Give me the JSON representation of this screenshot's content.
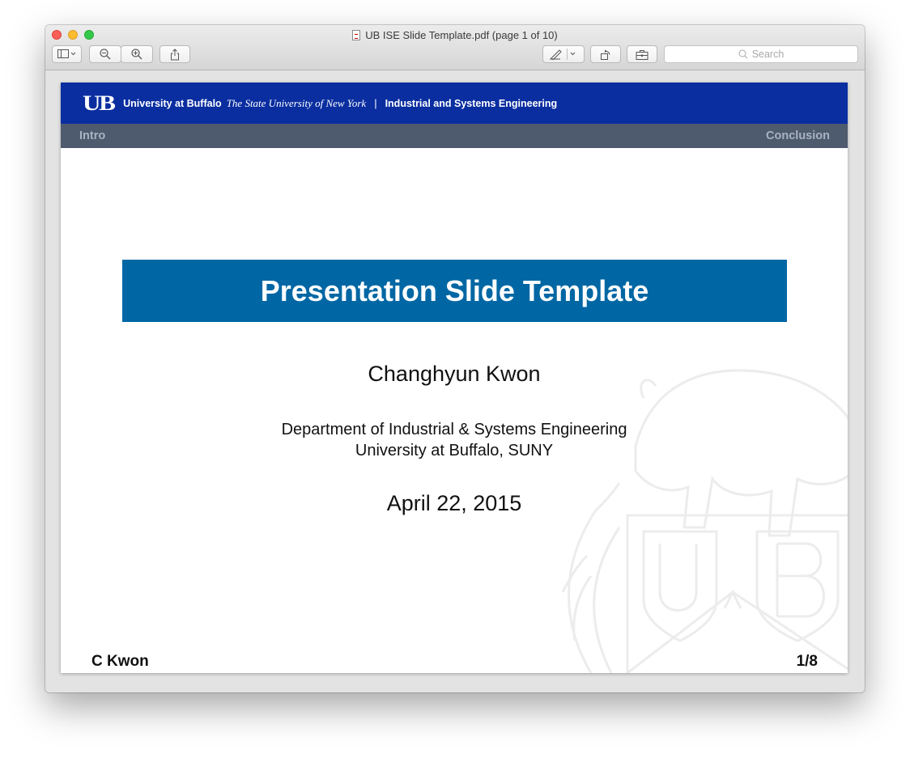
{
  "window": {
    "title": "UB ISE Slide Template.pdf (page 1 of 10)"
  },
  "toolbar": {
    "sidebar_icon": "sidebar-icon",
    "zoom_out_icon": "zoom-out-icon",
    "zoom_in_icon": "zoom-in-icon",
    "share_icon": "share-icon",
    "markup_icon": "markup-pen-icon",
    "rotate_icon": "rotate-icon",
    "toolbox_icon": "toolbox-icon",
    "search_placeholder": "Search"
  },
  "slide": {
    "header": {
      "logo": "UB",
      "university": "University at Buffalo",
      "state": "The State University of New York",
      "separator": "|",
      "department": "Industrial and Systems Engineering",
      "color": "#0a2ea0"
    },
    "nav": {
      "left": "Intro",
      "right": "Conclusion",
      "color": "#4e5a6e"
    },
    "title": "Presentation Slide Template",
    "title_color": "#0067a4",
    "author": "Changhyun Kwon",
    "department_line": "Department of Industrial & Systems Engineering",
    "university_line": "University at Buffalo, SUNY",
    "date": "April 22, 2015",
    "footer": {
      "author_short": "C Kwon",
      "page": "1/8"
    },
    "watermark": "ub-seal-watermark"
  }
}
